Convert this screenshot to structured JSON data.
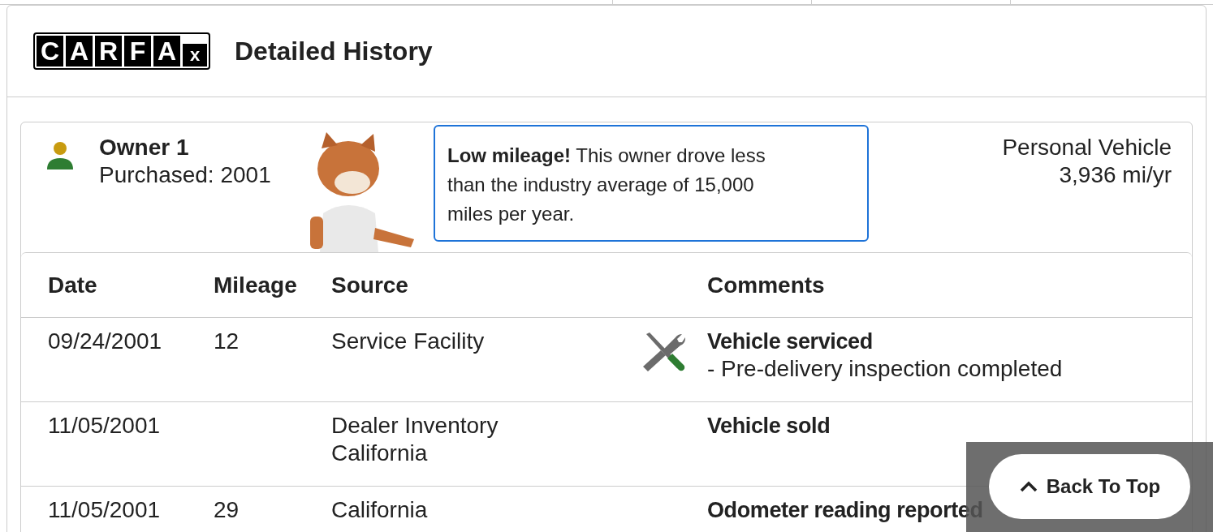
{
  "header": {
    "logo_letters": [
      "C",
      "A",
      "R",
      "F",
      "A",
      "x"
    ],
    "title": "Detailed History"
  },
  "owner": {
    "name": "Owner 1",
    "purchased": "Purchased: 2001",
    "callout": "**Low mileage!** This owner drove less than the industry average of 15,000 miles per year.",
    "usage": "Personal Vehicle",
    "rate": "3,936 mi/yr"
  },
  "table": {
    "columns": [
      "Date",
      "Mileage",
      "Source",
      "Comments"
    ],
    "rows": [
      {
        "date": "09/24/2001",
        "mileage": "12",
        "source": [
          "Service Facility"
        ],
        "kind": "service",
        "title": "Vehicle serviced",
        "details": [
          "- Pre-delivery inspection completed"
        ]
      },
      {
        "date": "11/05/2001",
        "source": [
          "Dealer Inventory",
          "California"
        ],
        "kind": "plain",
        "title": "Vehicle sold"
      },
      {
        "date": "11/05/2001",
        "mileage": "29",
        "source": [
          "California"
        ],
        "kind": "plain",
        "title": "Odometer reading reported"
      }
    ]
  },
  "back_to_top": {
    "label": "Back To Top"
  }
}
